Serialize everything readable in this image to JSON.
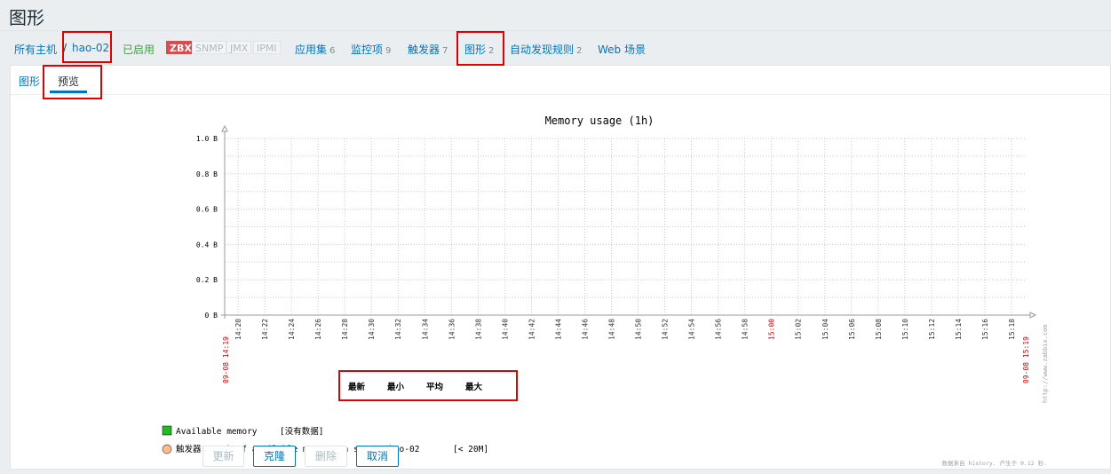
{
  "page": {
    "title": "图形"
  },
  "nav": {
    "all_hosts": "所有主机",
    "separator": "/",
    "host": "hao-02",
    "status": "已启用",
    "badges": [
      "ZBX",
      "SNMP",
      "JMX",
      "IPMI"
    ],
    "applications": {
      "label": "应用集",
      "count": "6"
    },
    "items": {
      "label": "监控项",
      "count": "9"
    },
    "triggers": {
      "label": "触发器",
      "count": "7"
    },
    "graphs": {
      "label": "图形",
      "count": "2"
    },
    "discovery": {
      "label": "自动发现规则",
      "count": "2"
    },
    "web": {
      "label": "Web 场景"
    }
  },
  "tabs": {
    "graph": "图形",
    "preview": "预览"
  },
  "chart_data": {
    "type": "line",
    "title": "Memory usage (1h)",
    "y_ticks": [
      "1.0 B",
      "0.8 B",
      "0.6 B",
      "0.4 B",
      "0.2 B",
      "0 B"
    ],
    "ylim": [
      0,
      1.0
    ],
    "x_start_label": "09-08 14:19",
    "x_end_label": "09-08 15:19",
    "x_ticks": [
      "14:20",
      "14:22",
      "14:24",
      "14:26",
      "14:28",
      "14:30",
      "14:32",
      "14:34",
      "14:36",
      "14:38",
      "14:40",
      "14:42",
      "14:44",
      "14:46",
      "14:48",
      "14:50",
      "14:52",
      "14:54",
      "14:56",
      "14:58",
      "15:00",
      "15:02",
      "15:04",
      "15:06",
      "15:08",
      "15:10",
      "15:12",
      "15:14",
      "15:16",
      "15:18"
    ],
    "x_ticks_red": [
      "15:00"
    ],
    "grid": true,
    "watermark": "http://www.zabbix.com",
    "stats_headers": [
      "最新",
      "最小",
      "平均",
      "最大"
    ],
    "series": [
      {
        "name": "Available memory",
        "status": "[没有数据]",
        "color": "#22bb22"
      }
    ],
    "trigger": {
      "label": "触发器: Lack of available memory on server hao-02",
      "threshold": "[< 20M]",
      "color": "#ffbb88"
    },
    "footer_note": "数据来自 history. 产生于 0.12 秒."
  },
  "buttons": {
    "update": "更新",
    "clone": "克隆",
    "delete": "删除",
    "cancel": "取消"
  },
  "colors": {
    "link": "#0275b8",
    "enabled": "#429e47",
    "zbx_badge": "#d64e4e",
    "highlight_box": "#e00000"
  }
}
